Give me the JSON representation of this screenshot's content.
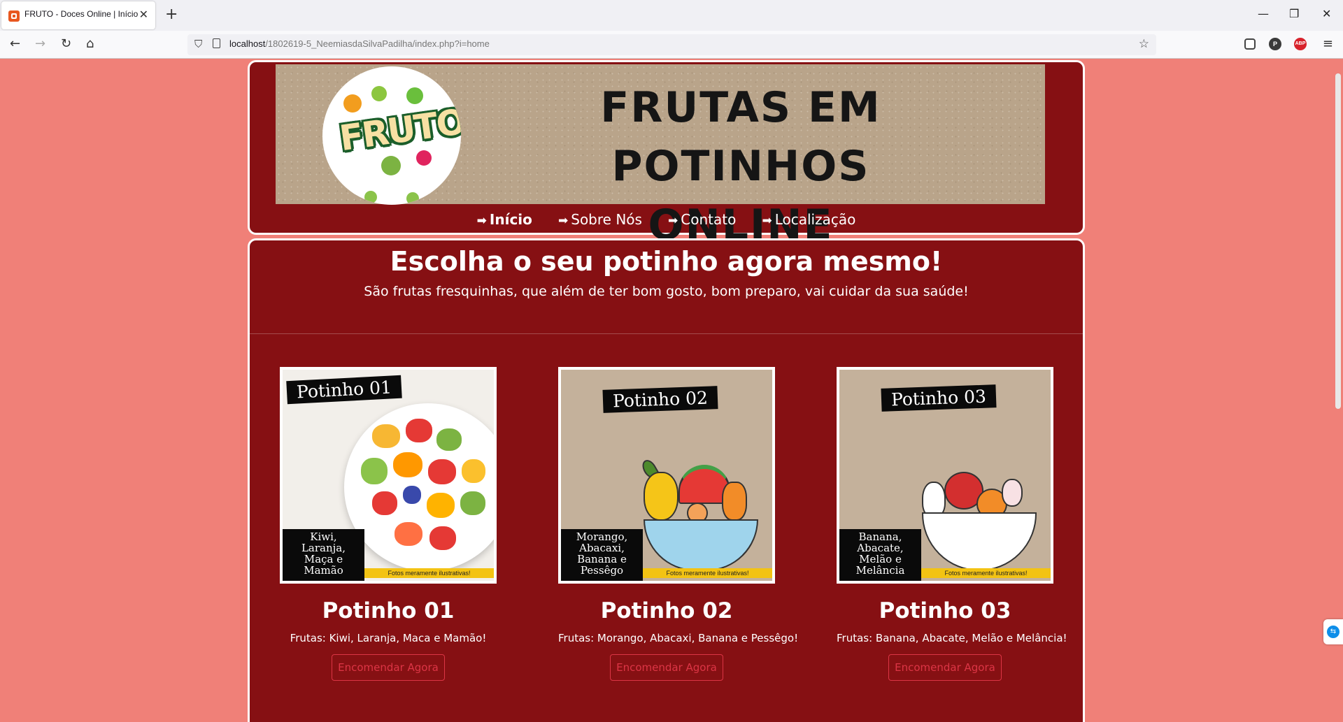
{
  "browser": {
    "tab_title": "FRUTO - Doces Online | Início",
    "tab_close": "✕",
    "new_tab": "+",
    "url_host": "localhost",
    "url_path": "/1802619-5_NeemiasdaSilvaPadilha/index.php?i=home",
    "window_minimize": "—",
    "window_restore": "❐",
    "window_close": "✕",
    "ext_profile": "P",
    "ext_adblock": "ABP"
  },
  "header": {
    "logo_text": "FRUTO",
    "banner_title_line1": "FRUTAS EM POTINHOS",
    "banner_title_line2": "ONLINE"
  },
  "menu": {
    "icon": "➡",
    "items": [
      {
        "label": "Início",
        "active": true
      },
      {
        "label": "Sobre Nós",
        "active": false
      },
      {
        "label": "Contato",
        "active": false
      },
      {
        "label": "Localização",
        "active": false
      }
    ]
  },
  "hero": {
    "title": "Escolha o seu potinho agora mesmo!",
    "subtitle": "São frutas fresquinhas, que além de ter bom gosto, bom preparo, vai cuidar da sua saúde!"
  },
  "products": [
    {
      "badge": "Potinho 01",
      "label_lines": [
        "Kiwi,",
        "Laranja,",
        "Maça e",
        "Mamão"
      ],
      "disclaimer": "Fotos meramente ilustrativas!",
      "name": "Potinho 01",
      "description": "Frutas: Kiwi, Laranja, Maca e Mamão!",
      "button": "Encomendar Agora"
    },
    {
      "badge": "Potinho 02",
      "label_lines": [
        "Morango,",
        "Abacaxi,",
        "Banana e",
        "Pessêgo"
      ],
      "disclaimer": "Fotos meramente ilustrativas!",
      "name": "Potinho 02",
      "description": "Frutas: Morango, Abacaxi, Banana e Pessêgo!",
      "button": "Encomendar Agora"
    },
    {
      "badge": "Potinho 03",
      "label_lines": [
        "Banana,",
        "Abacate,",
        "Melão e",
        "Melância"
      ],
      "disclaimer": "Fotos meramente ilustrativas!",
      "name": "Potinho 03",
      "description": "Frutas: Banana, Abacate, Melão e Melância!",
      "button": "Encomendar Agora"
    }
  ],
  "colors": {
    "page_background": "#f08078",
    "card_background": "#861013",
    "button_accent": "#dc3545",
    "disclaimer_yellow": "#f3c313"
  },
  "icons": {
    "back": "←",
    "forward": "→",
    "reload": "↻",
    "home": "⌂",
    "shield": "⛉",
    "star": "☆",
    "menu": "≡"
  }
}
